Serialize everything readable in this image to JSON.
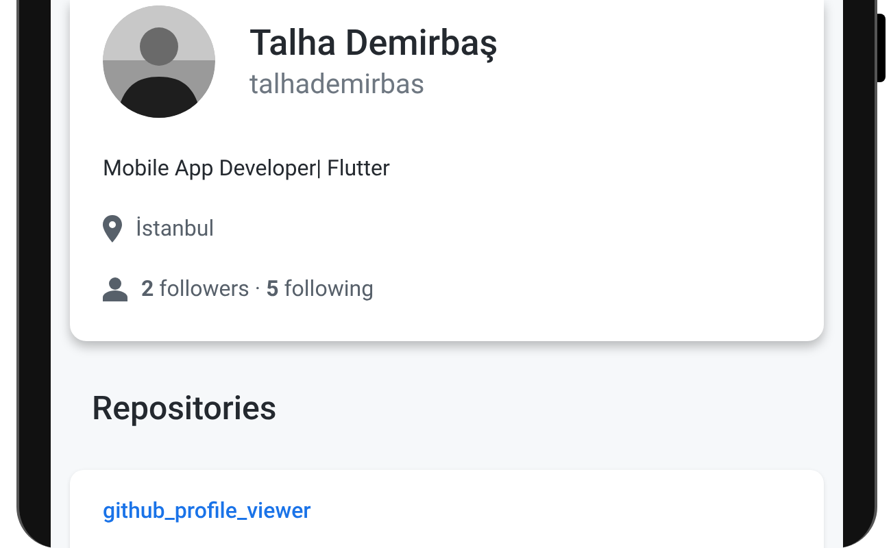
{
  "profile": {
    "name": "Talha Demirbaş",
    "username": "talhademirbas",
    "bio": "Mobile App Developer| Flutter",
    "location": "İstanbul",
    "follow_stats": "**2** followers · **5** following"
  },
  "repositories": {
    "title": "Repositories",
    "items": [
      {
        "name": "github_profile_viewer"
      }
    ]
  }
}
